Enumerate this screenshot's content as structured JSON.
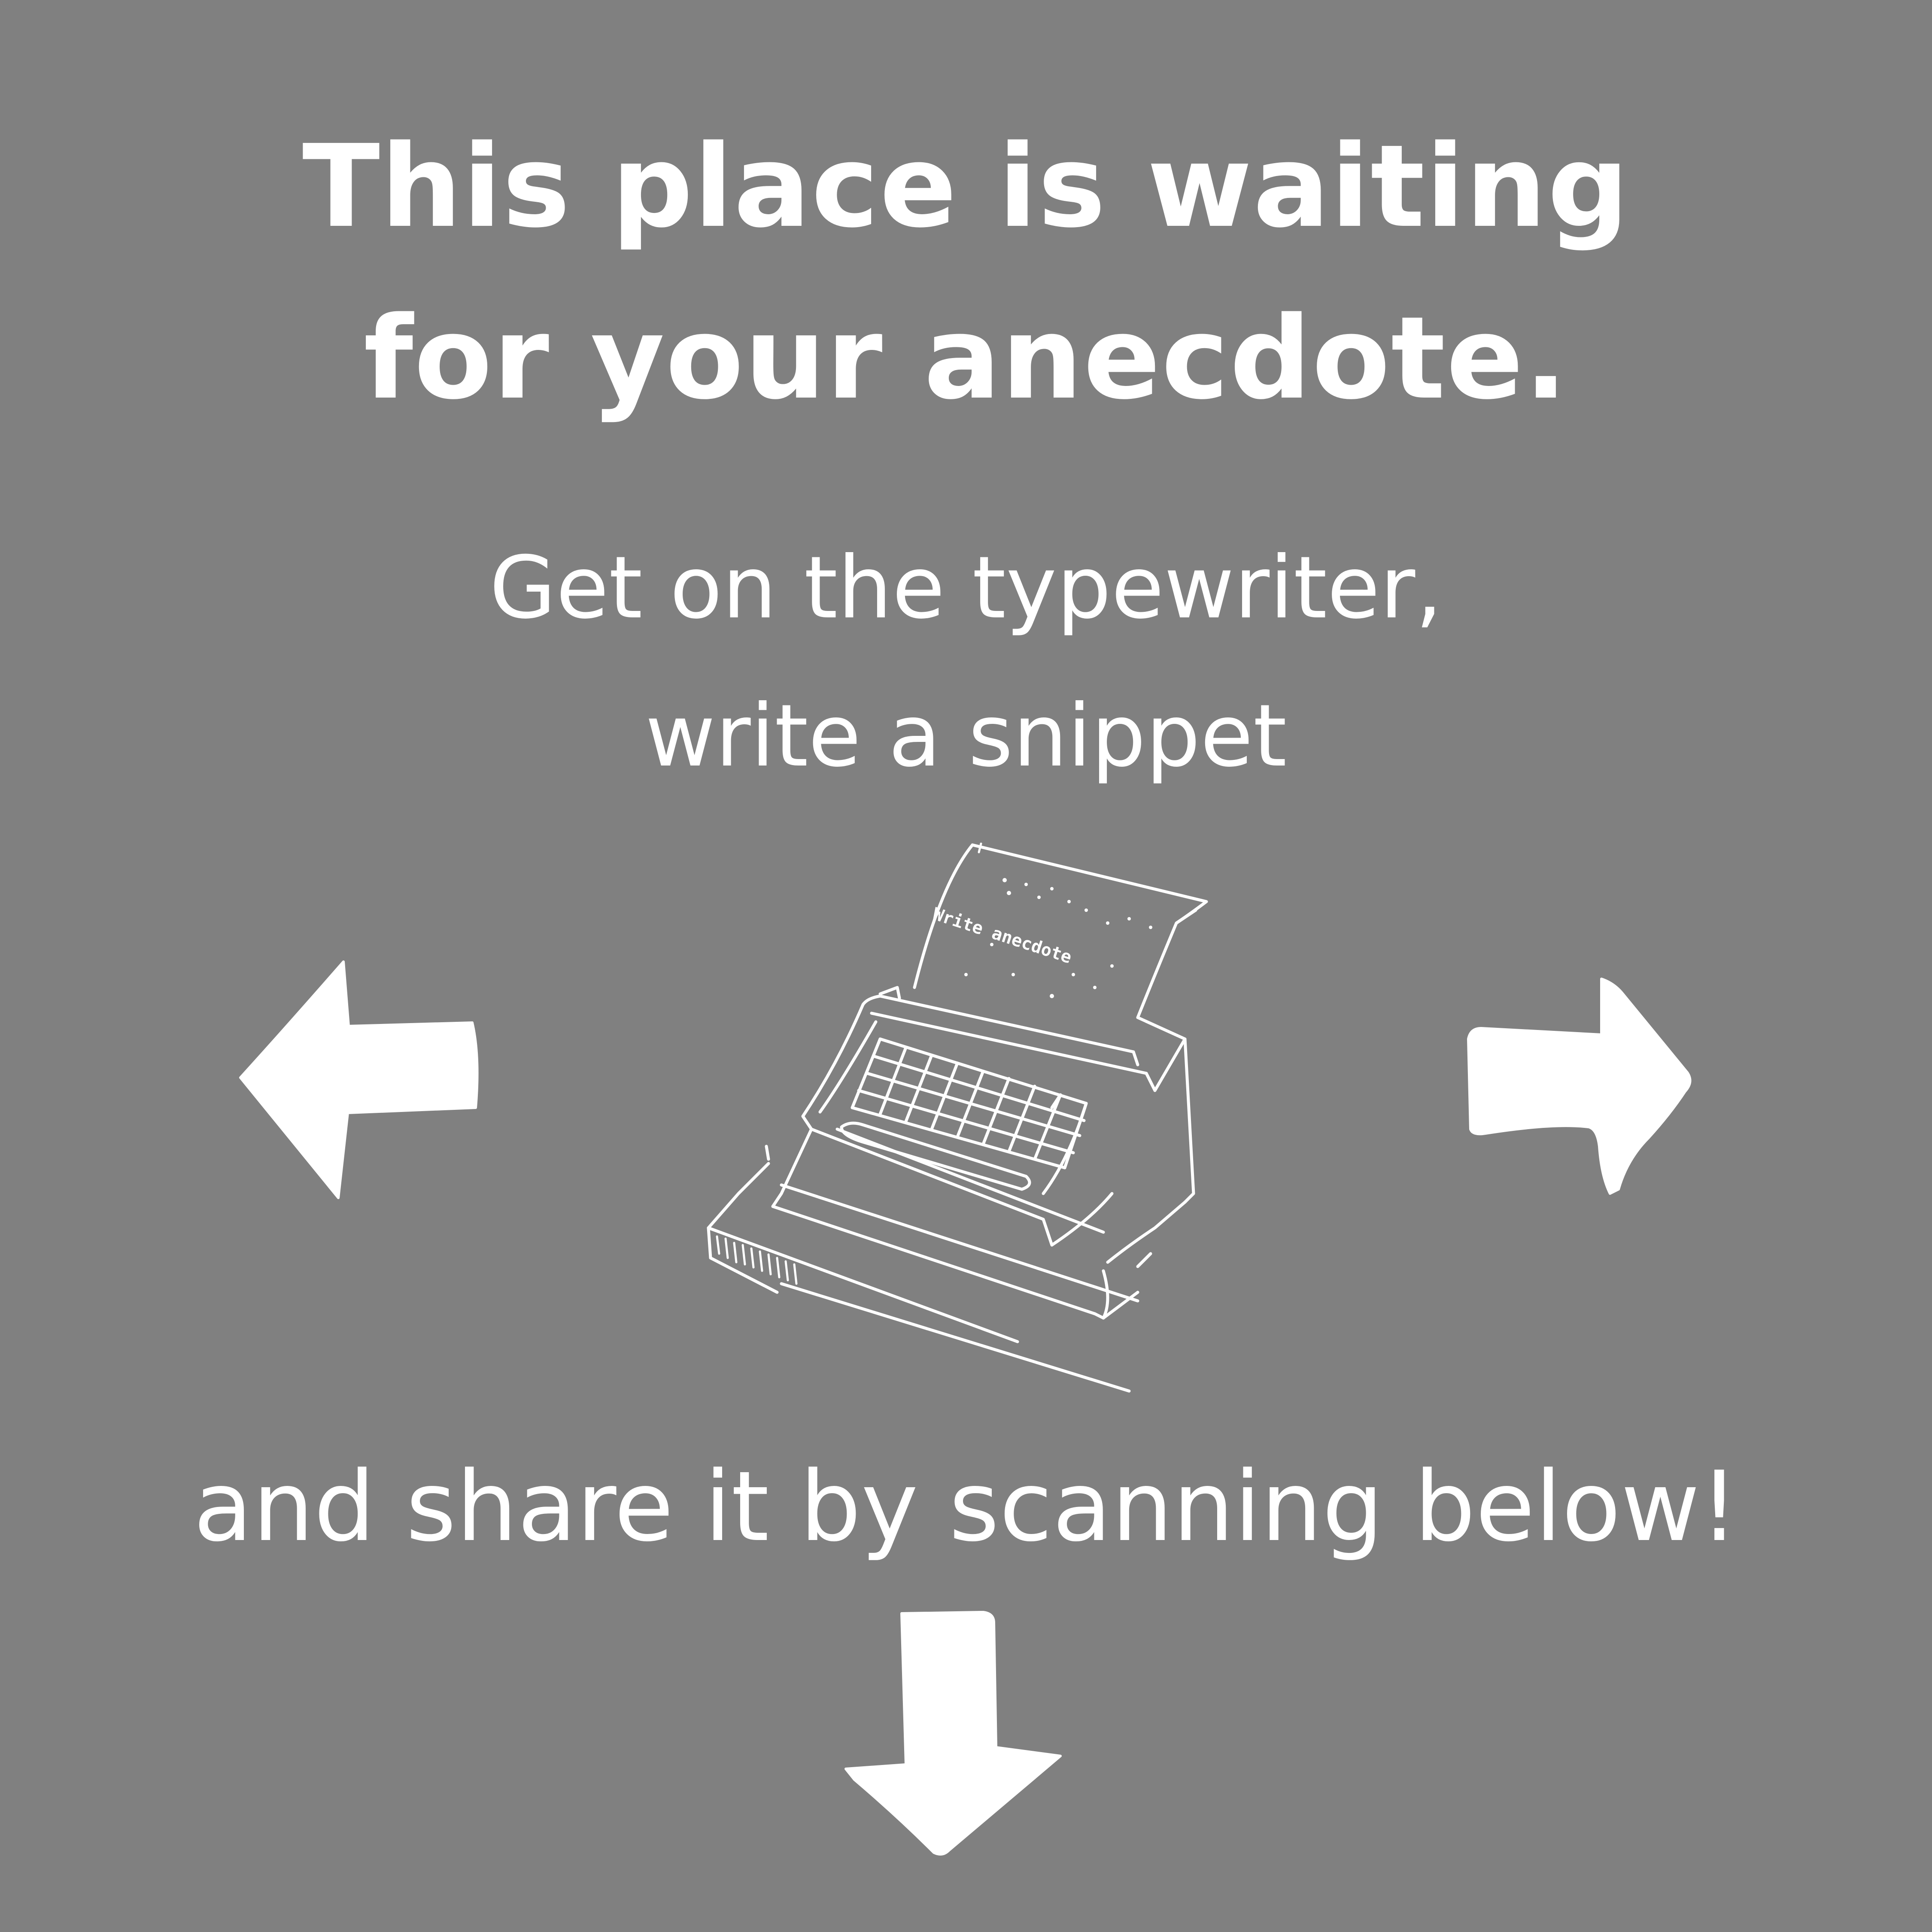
{
  "colors": {
    "background": "#808080",
    "foreground": "#ffffff"
  },
  "headline": {
    "line1": "This place is waiting",
    "line2": "for your anecdote."
  },
  "instructions": {
    "line1": "Get on the typewriter,",
    "line2": "write a snippet"
  },
  "typewriter_illustration": {
    "icon": "typewriter-icon",
    "paper_text": "Write anecdote"
  },
  "share_line": "and share it by scanning below!",
  "arrows": {
    "left": "arrow-left-icon",
    "right": "arrow-right-icon",
    "down": "arrow-down-icon"
  }
}
